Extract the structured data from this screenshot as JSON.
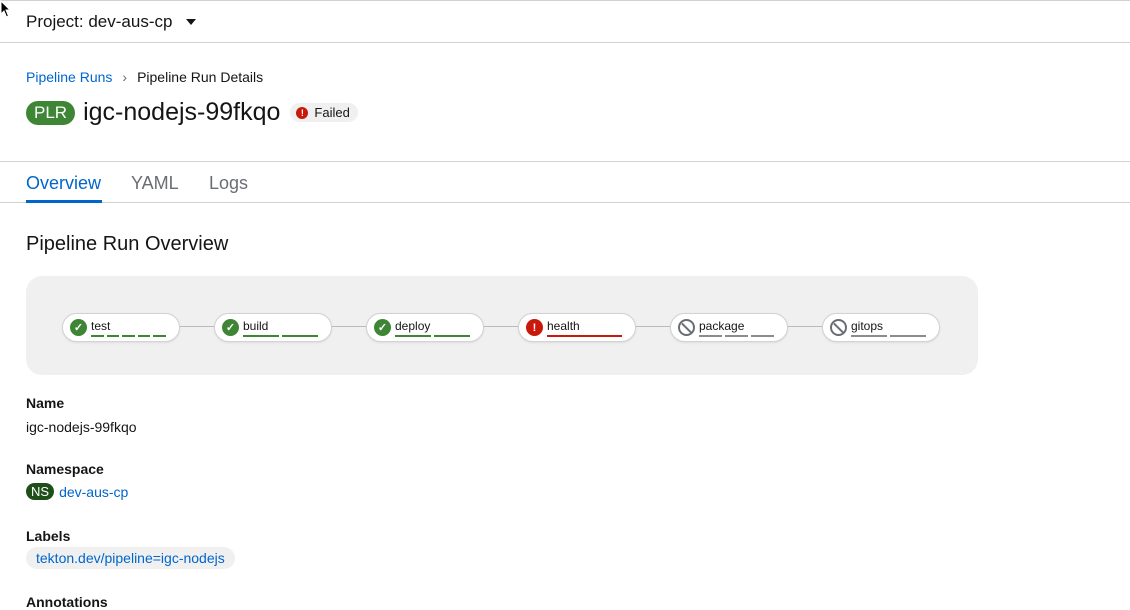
{
  "project": {
    "label": "Project: dev-aus-cp"
  },
  "breadcrumb": {
    "parent": "Pipeline Runs",
    "current": "Pipeline Run Details"
  },
  "header": {
    "badge": "PLR",
    "title": "igc-nodejs-99fkqo",
    "status": "Failed"
  },
  "tabs": [
    {
      "label": "Overview",
      "active": true
    },
    {
      "label": "YAML",
      "active": false
    },
    {
      "label": "Logs",
      "active": false
    }
  ],
  "overview": {
    "title": "Pipeline Run Overview"
  },
  "pipeline": {
    "tasks": [
      {
        "name": "test",
        "status": "succeeded",
        "steps": 5
      },
      {
        "name": "build",
        "status": "succeeded",
        "steps": 2
      },
      {
        "name": "deploy",
        "status": "succeeded",
        "steps": 2
      },
      {
        "name": "health",
        "status": "failed",
        "steps": 1
      },
      {
        "name": "package",
        "status": "skipped",
        "steps": 3
      },
      {
        "name": "gitops",
        "status": "skipped",
        "steps": 2
      }
    ],
    "colors": {
      "succeeded": "#3e8635",
      "failed": "#c9190b",
      "skipped": "#8a8d90"
    }
  },
  "details": {
    "name_label": "Name",
    "name_value": "igc-nodejs-99fkqo",
    "namespace_label": "Namespace",
    "namespace_badge": "NS",
    "namespace_value": "dev-aus-cp",
    "labels_label": "Labels",
    "labels": [
      "tekton.dev/pipeline=igc-nodejs"
    ],
    "annotations_label": "Annotations"
  }
}
